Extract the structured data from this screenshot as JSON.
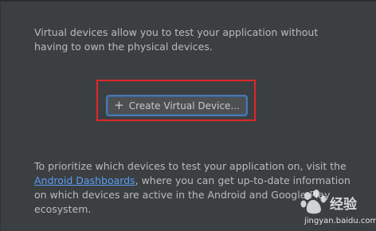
{
  "intro": {
    "line1": "Virtual devices allow you to test your application without",
    "line2": "having to own the physical devices."
  },
  "create_button": {
    "icon": "plus-icon",
    "label": "Create Virtual Device..."
  },
  "footer": {
    "text_before": "To prioritize which devices to test your application on, visit the ",
    "link": "Android Dashboards",
    "text_after": ", where you can get up-to-date information on which devices are active in the Android and Google Play ecosystem."
  },
  "watermark": {
    "title": "经验",
    "url": "jingyan.baidu.com"
  },
  "colors": {
    "background": "#3c3f41",
    "text": "#bbbbbb",
    "link": "#589df6",
    "highlight": "#e0262a",
    "button_border": "#4a78b3"
  }
}
